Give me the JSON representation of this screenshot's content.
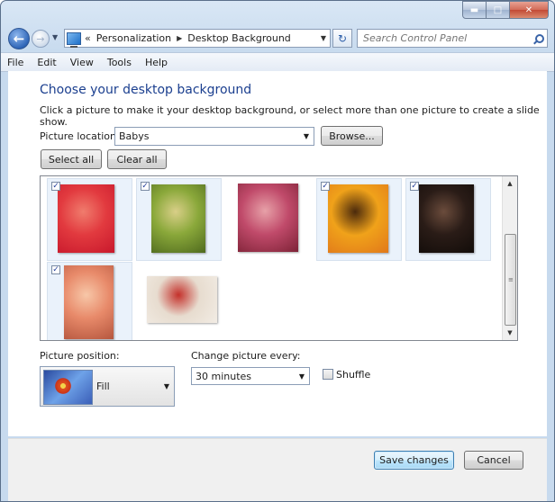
{
  "window": {
    "caption_buttons": {
      "minimize": "minimize-icon",
      "maximize": "maximize-icon",
      "close": "close-icon"
    }
  },
  "nav": {
    "breadcrumbs": [
      "Personalization",
      "Desktop Background"
    ],
    "overflow": "«",
    "search_placeholder": "Search Control Panel"
  },
  "menu": [
    "File",
    "Edit",
    "View",
    "Tools",
    "Help"
  ],
  "page": {
    "title": "Choose your desktop background",
    "subtitle": "Click a picture to make it your desktop background, or select more than one picture to create a slide show."
  },
  "location": {
    "label": "Picture location:",
    "value": "Babys",
    "browse": "Browse..."
  },
  "selection": {
    "select_all": "Select all",
    "clear_all": "Clear all"
  },
  "pictures": [
    {
      "checked": true,
      "colors": [
        "#e23a3f",
        "#f07c6d",
        "#c8182c"
      ]
    },
    {
      "checked": true,
      "colors": [
        "#8aa83a",
        "#d9cf88",
        "#4f6a1e"
      ]
    },
    {
      "checked": false,
      "colors": [
        "#c04a6a",
        "#e7a1a8",
        "#7d2236"
      ]
    },
    {
      "checked": true,
      "colors": [
        "#f0a21a",
        "#4b2a0c",
        "#e1781a"
      ]
    },
    {
      "checked": true,
      "colors": [
        "#2a1c17",
        "#6b4c3c",
        "#120c09"
      ]
    },
    {
      "checked": true,
      "colors": [
        "#e88a6a",
        "#f7c7a8",
        "#b5563e"
      ]
    },
    {
      "checked": false,
      "colors": [
        "#e7dccf",
        "#c4312b",
        "#f2ece4"
      ]
    }
  ],
  "position": {
    "label": "Picture position:",
    "value": "Fill"
  },
  "interval": {
    "label": "Change picture every:",
    "value": "30 minutes"
  },
  "shuffle": {
    "label": "Shuffle",
    "checked": false
  },
  "footer": {
    "save": "Save changes",
    "cancel": "Cancel"
  }
}
